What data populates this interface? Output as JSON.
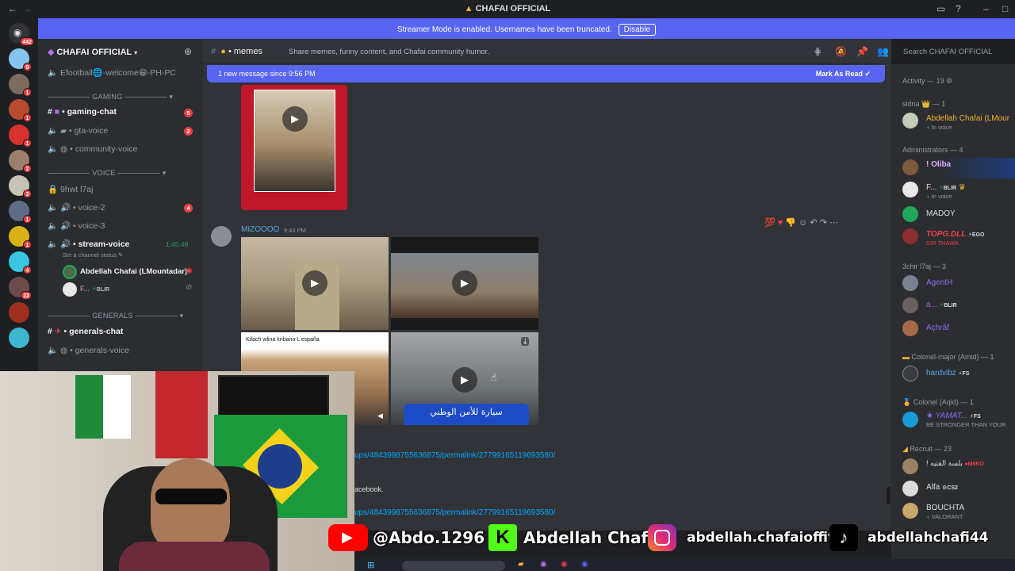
{
  "window": {
    "title": "CHAFAI OFFICIAL"
  },
  "banner": {
    "text": "Streamer Mode is enabled. Usernames have been truncated.",
    "button": "Disable"
  },
  "rail": {
    "home_badge": "442",
    "badges": [
      "9",
      "1",
      "1",
      "1",
      "2",
      "3",
      "1",
      "1",
      "4",
      "22"
    ]
  },
  "sidebar": {
    "server_name": "CHAFAI OFFICIAL",
    "top_channel": "Efootball🌐-welcome😁-PH-PC",
    "cat_gaming": "GAMING",
    "gaming_chat": "gaming-chat",
    "gaming_chat_badge": "5",
    "gta_voice": "gta-voice",
    "gta_voice_badge": "2",
    "community_voice": "community-voice",
    "cat_voice": "VOICE",
    "ch_9hwt": "9hwt l7aj",
    "voice2": "voice-2",
    "voice2_badge": "4",
    "voice3": "voice-3",
    "stream_voice": "stream-voice",
    "stream_time": "1:45:49",
    "status_hint": "Set a channel status",
    "user1": "Abdellah Chafai (LMountadar)",
    "user2": "F...",
    "user2_tag": "BLIR",
    "cat_generals": "GENERALS",
    "generals_chat": "generals-chat",
    "generals_voice": "generals-voice"
  },
  "chat": {
    "channel": "memes",
    "topic": "Share memes, funny content, and Chafai community humor.",
    "new_message": "1 new message since 9:56 PM",
    "mark_read": "Mark As Read",
    "author": "MIZOOOO",
    "time": "9:43 PM",
    "media_caption": "Kifach wlina knbano L españa",
    "arabic_caption": "سيارة للأمن الوطني",
    "link1": "ups/4843998755636875/permalink/27799165119693580/",
    "facebook": "acebook.",
    "link2": "ups/4843998755636875/permalink/27799165119693580/"
  },
  "members": {
    "search_placeholder": "Search CHAFAI OFFICIAL",
    "activity": "Activity — 19",
    "g_sidna": "sidna 👑 — 1",
    "m_abdellah": "Abdellah Chafai (LMour",
    "in_voice": "In voice",
    "g_admins": "Administrators — 4",
    "m_oliba": "! Oliba",
    "m_f": "F...",
    "tag_blir": "BLIR",
    "m_madoy": "MADOY",
    "m_topg": "TOPG.DLL",
    "tag_ego": "EGO",
    "sub_sir": "SIR THAWA",
    "g_3chir": "3chir l7aj — 3",
    "m_agent": "AgentH",
    "m_a": "a...",
    "m_achraf": "Açhrãf",
    "g_colonel_major": "Colonel-major (Amid) — 1",
    "m_hardvibz": "hardvibz",
    "tag_fs": "FS",
    "g_colonel": "Colonel (Aqid) — 1",
    "m_yamat": "★ YAMAT...",
    "sub_stronger": "BE STRONGER THAN YOUR",
    "g_recruit": "Recruit — 23",
    "m_balsa": "! بلسة القتيه",
    "tag_m6ko": "M6KO",
    "m_alfa": "Alfa",
    "tag_cs2": "CS2",
    "m_bouchta": "BOUCHTA",
    "sub_valorant": "VALORANT"
  },
  "social": {
    "youtube": "@Abdo.1296",
    "kick": "Abdellah Chafai",
    "instagram": "abdellah.chafaioffitid",
    "tiktok": "abdellahchafi44"
  },
  "colors": {
    "blurple": "#5865f2",
    "red": "#f23f43",
    "green": "#23a55a",
    "bg": "#313338"
  }
}
